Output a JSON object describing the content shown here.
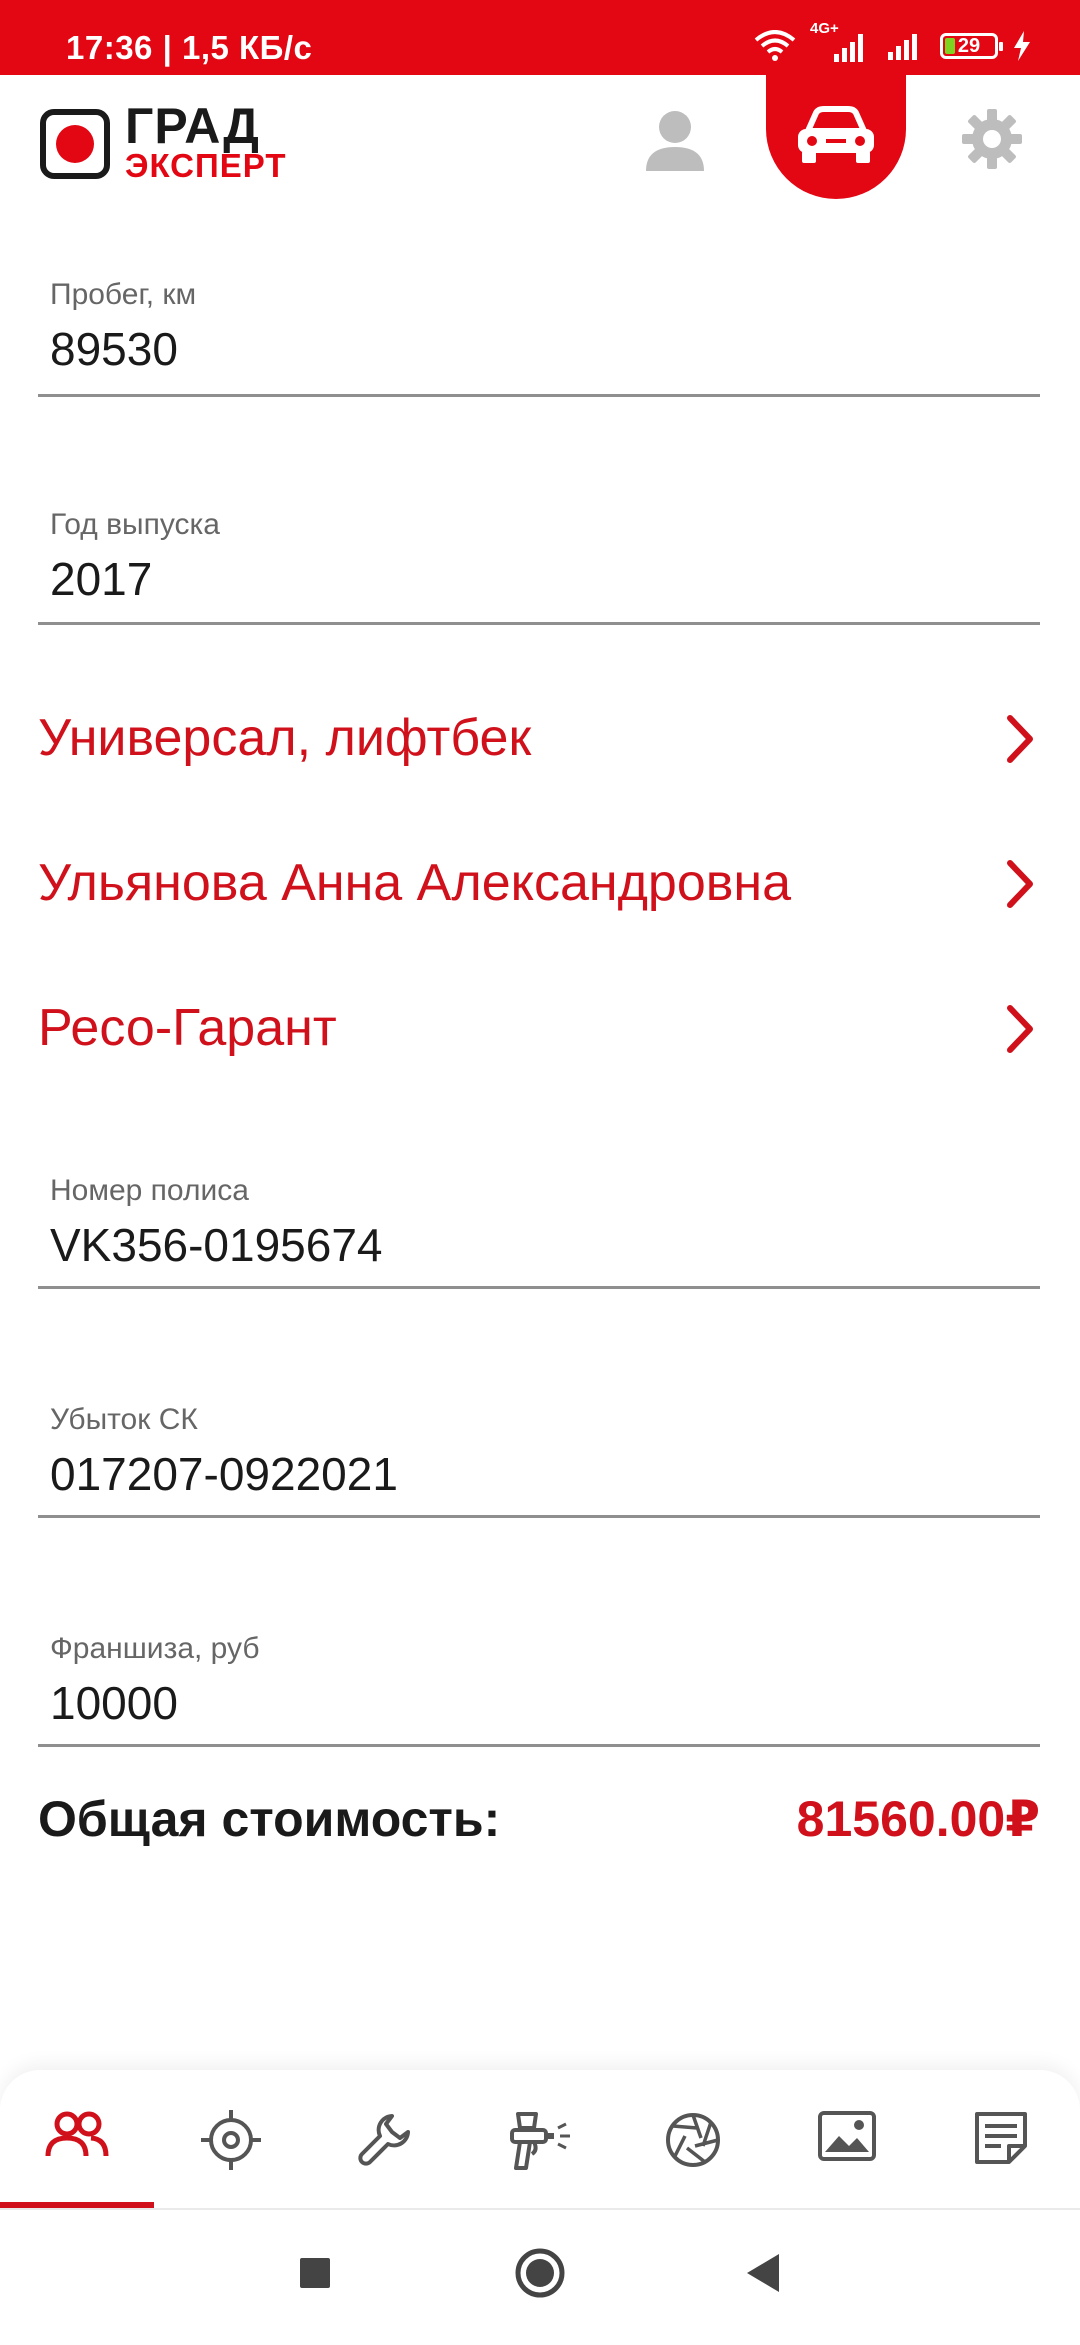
{
  "status_bar": {
    "time_speed": "17:36 | 1,5 КБ/с",
    "network": "4G+",
    "battery": "29"
  },
  "header": {
    "logo_top": "ГРАД",
    "logo_bottom": "ЭКСПЕРТ",
    "icons": [
      "user-icon",
      "car-icon",
      "gear-icon"
    ],
    "active_icon": "car-icon"
  },
  "fields": {
    "mileage": {
      "label": "Пробег, км",
      "value": "89530"
    },
    "year": {
      "label": "Год выпуска",
      "value": "2017"
    },
    "policy": {
      "label": "Номер полиса",
      "value": "VK356-0195674"
    },
    "loss": {
      "label": "Убыток СК",
      "value": "017207-0922021"
    },
    "deductible": {
      "label": "Франшиза, руб",
      "value": "10000"
    }
  },
  "links": {
    "body_type": "Универсал, лифтбек",
    "owner": "Ульянова Анна Александровна",
    "insurer": "Ресо-Гарант"
  },
  "total": {
    "label": "Общая стоимость:",
    "value": "81560.00₽"
  },
  "bottom_nav": {
    "items": [
      "people-icon",
      "target-icon",
      "wrench-icon",
      "spray-gun-icon",
      "aperture-icon",
      "image-icon",
      "notes-icon"
    ],
    "active": "people-icon"
  },
  "system_nav": [
    "recents-icon",
    "home-icon",
    "back-icon"
  ],
  "colors": {
    "brand_red": "#e30613",
    "link_red": "#d0111b",
    "icon_gray": "#bdbdbd",
    "nav_icon_gray": "#555555"
  }
}
